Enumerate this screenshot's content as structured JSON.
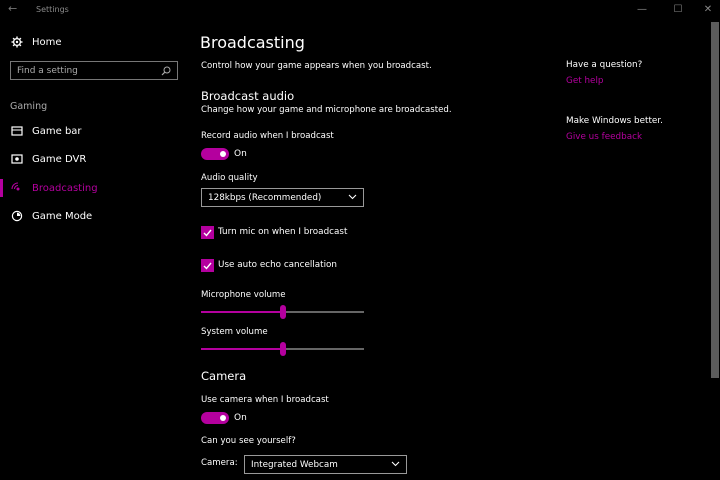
{
  "window": {
    "title": "Settings",
    "back_icon": "back-arrow-icon",
    "minimize": "—",
    "maximize": "☐",
    "close": "✕"
  },
  "sidebar": {
    "home_label": "Home",
    "search_placeholder": "Find a setting",
    "section_label": "Gaming",
    "items": [
      {
        "label": "Game bar",
        "icon": "game-bar-icon"
      },
      {
        "label": "Game DVR",
        "icon": "game-dvr-icon"
      },
      {
        "label": "Broadcasting",
        "icon": "broadcasting-icon",
        "active": true
      },
      {
        "label": "Game Mode",
        "icon": "game-mode-icon"
      }
    ]
  },
  "main": {
    "title": "Broadcasting",
    "description": "Control how your game appears when you broadcast.",
    "audio": {
      "heading": "Broadcast audio",
      "description": "Change how your game and microphone are broadcasted.",
      "record_label": "Record audio when I broadcast",
      "record_state": "On",
      "quality_label": "Audio quality",
      "quality_value": "128kbps (Recommended)",
      "mic_checkbox": "Turn mic on when I broadcast",
      "echo_checkbox": "Use auto echo cancellation",
      "mic_volume_label": "Microphone volume",
      "mic_volume": 50,
      "system_volume_label": "System volume",
      "system_volume": 50
    },
    "camera": {
      "heading": "Camera",
      "use_label": "Use camera when I broadcast",
      "use_state": "On",
      "see_label": "Can you see yourself?",
      "camera_label": "Camera:",
      "camera_value": "Integrated Webcam"
    }
  },
  "aside": {
    "question": "Have a question?",
    "help_link": "Get help",
    "better": "Make Windows better.",
    "feedback_link": "Give us feedback"
  },
  "colors": {
    "accent": "#b4009e",
    "background": "#000000"
  }
}
